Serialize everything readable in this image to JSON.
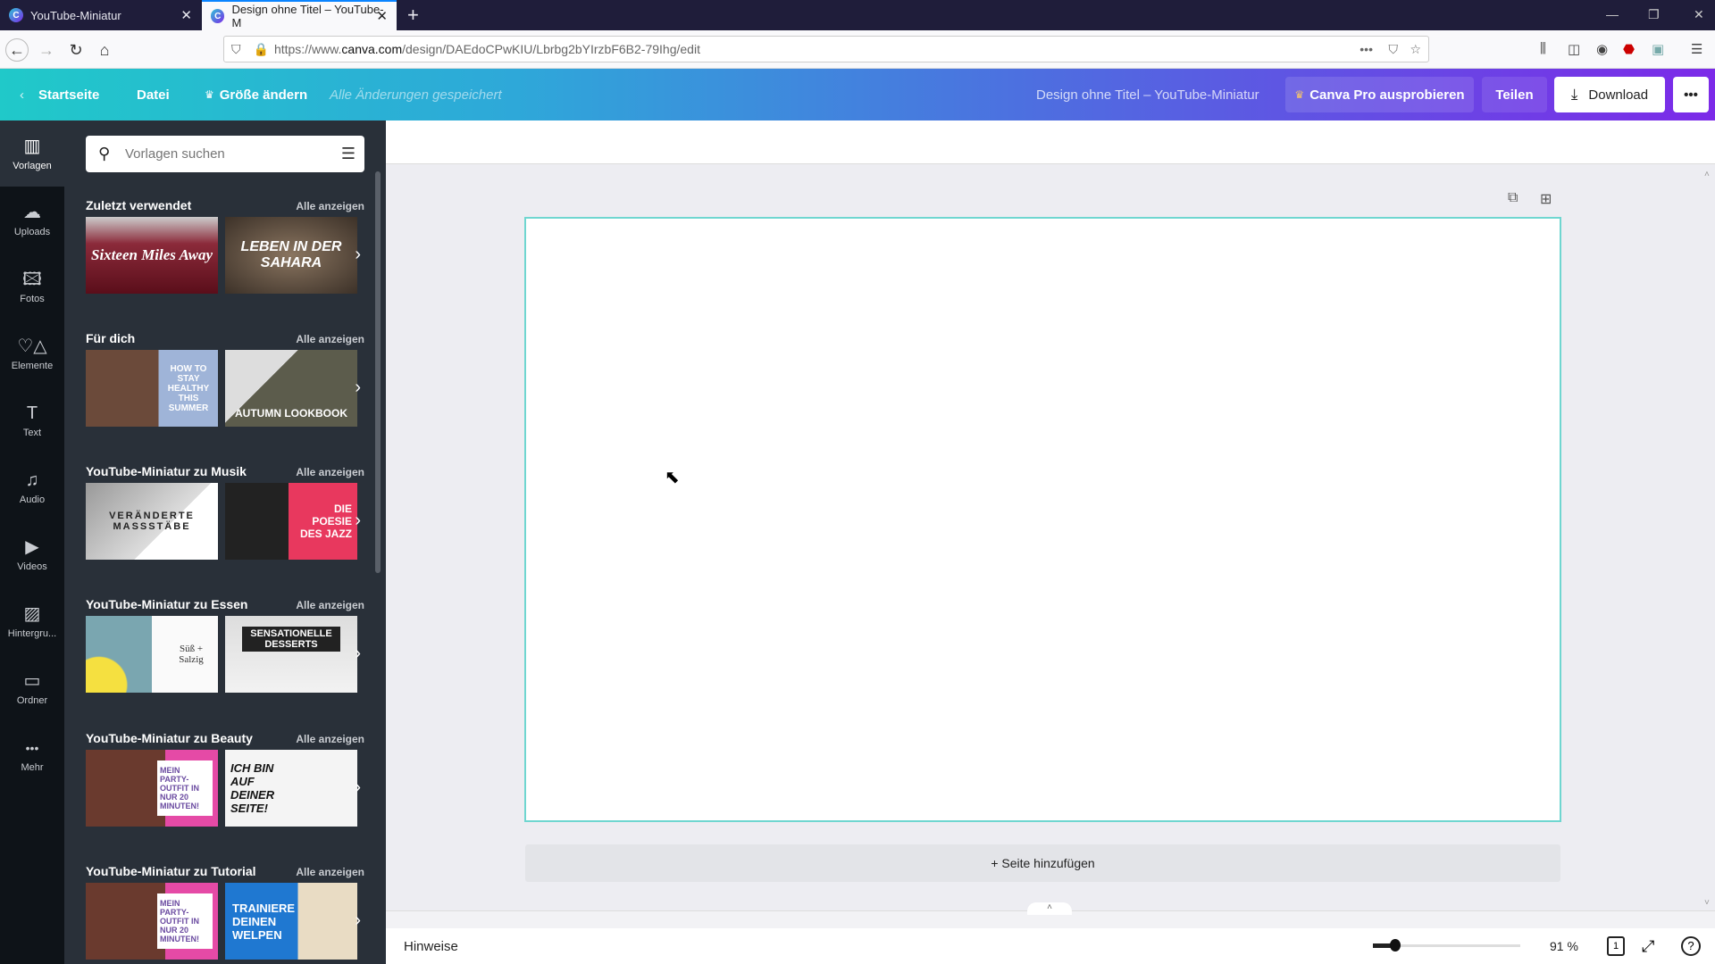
{
  "browser": {
    "tabs": [
      {
        "label": "YouTube-Miniatur",
        "favicon": "C"
      },
      {
        "label": "Design ohne Titel – YouTube-M",
        "favicon": "C"
      }
    ],
    "url_prefix": "https://www.",
    "url_domain": "canva.com",
    "url_path": "/design/DAEdoCPwKIU/Lbrbg2bYIrzbF6B2-79Ihg/edit"
  },
  "header": {
    "back_label": "Startseite",
    "file_label": "Datei",
    "resize_label": "Größe ändern",
    "save_status": "Alle Änderungen gespeichert",
    "doc_title": "Design ohne Titel – YouTube-Miniatur",
    "pro_label": "Canva Pro ausprobieren",
    "share_label": "Teilen",
    "download_label": "Download",
    "more_label": "•••"
  },
  "rail": [
    {
      "label": "Vorlagen",
      "icon": "▥"
    },
    {
      "label": "Uploads",
      "icon": "☁"
    },
    {
      "label": "Fotos",
      "icon": "🖾"
    },
    {
      "label": "Elemente",
      "icon": "♡△"
    },
    {
      "label": "Text",
      "icon": "T"
    },
    {
      "label": "Audio",
      "icon": "♫"
    },
    {
      "label": "Videos",
      "icon": "▶"
    },
    {
      "label": "Hintergru...",
      "icon": "▨"
    },
    {
      "label": "Ordner",
      "icon": "▭"
    },
    {
      "label": "Mehr",
      "icon": "•••"
    }
  ],
  "panel": {
    "search_placeholder": "Vorlagen suchen",
    "see_all": "Alle anzeigen",
    "sections": [
      {
        "title": "Zuletzt verwendet",
        "thumbs": [
          "Sixteen Miles Away",
          "LEBEN IN DER SAHARA"
        ]
      },
      {
        "title": "Für dich",
        "thumbs": [
          "HOW TO STAY HEALTHY THIS SUMMER",
          "AUTUMN LOOKBOOK"
        ]
      },
      {
        "title": "YouTube-Miniatur zu Musik",
        "thumbs": [
          "VERÄNDERTE MASSSTÄBE",
          "DIE POESIE DES JAZZ"
        ]
      },
      {
        "title": "YouTube-Miniatur zu Essen",
        "thumbs": [
          "Süß + Salzig",
          "SENSATIONELLE DESSERTS"
        ]
      },
      {
        "title": "YouTube-Miniatur zu Beauty",
        "thumbs": [
          "MEIN PARTY-OUTFIT IN NUR 20 MINUTEN!",
          "ICH BIN AUF DEINER SEITE!"
        ]
      },
      {
        "title": "YouTube-Miniatur zu Tutorial",
        "thumbs": [
          "MEIN PARTY-OUTFIT IN NUR 20 MINUTEN!",
          "TRAINIERE DEINEN WELPEN"
        ]
      }
    ]
  },
  "editor": {
    "add_page_label": "+ Seite hinzufügen",
    "notes_label": "Hinweise",
    "zoom_level": "91 %",
    "zoom_fraction": 0.15,
    "page_count": "1"
  }
}
